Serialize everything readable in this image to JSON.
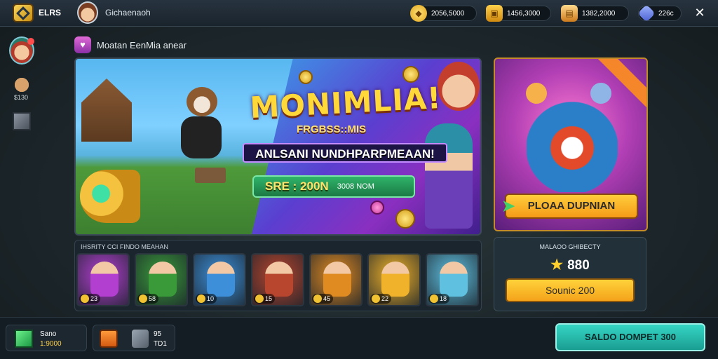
{
  "topbar": {
    "brand": "ELRS",
    "username": "Gichaenaoh",
    "resources": [
      {
        "name": "gold",
        "value": "2056,5000"
      },
      {
        "name": "chest",
        "value": "1456,3000"
      },
      {
        "name": "cards",
        "value": "1382,2000"
      },
      {
        "name": "gems",
        "value": "226c"
      }
    ],
    "close_label": "✕"
  },
  "rail": {
    "char_label": "$130"
  },
  "event": {
    "title": "Moatan EenMia anear"
  },
  "banner": {
    "title": "MONIMLIA!",
    "subtitle": "FRGBSS::MIS",
    "strip": "ANLSANI NUNDHPARPMEAAN!",
    "cta_big": "SRE : 200N",
    "cta_small": "3008 NOM"
  },
  "hero_card": {
    "ribbon": "",
    "cta_label": "PLOAA DUPNIAN"
  },
  "heroes_row": {
    "title": "IHSRITY CCI FINDO MEAHAN",
    "tiles": [
      {
        "cost": "23",
        "color": "#b23fcf"
      },
      {
        "cost": "58",
        "color": "#3a9a3a"
      },
      {
        "cost": "10",
        "color": "#3c8fd8"
      },
      {
        "cost": "15",
        "color": "#b8452e"
      },
      {
        "cost": "45",
        "color": "#e08a22"
      },
      {
        "cost": "22",
        "color": "#f0b22a"
      },
      {
        "cost": "18",
        "color": "#5fc0e0"
      }
    ]
  },
  "wallet": {
    "title": "MALAOO GHIBECTY",
    "amount": "880",
    "button_label": "Sounic 200"
  },
  "bottom": {
    "balance_label": "Sano",
    "balance_value": "1:9000",
    "inv_label1": "95",
    "inv_label2": "TD1",
    "saldo_button": "SALDO DOMPET 300"
  }
}
